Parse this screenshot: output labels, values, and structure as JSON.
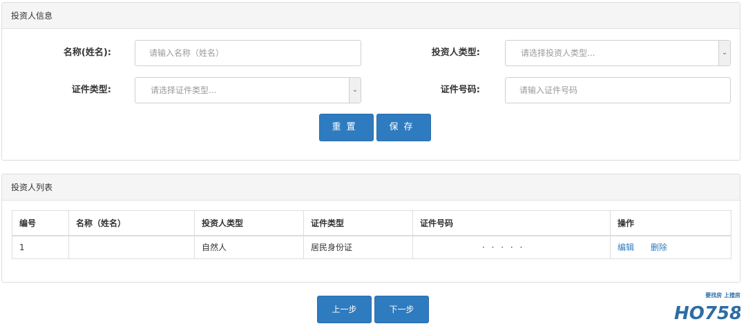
{
  "info_panel": {
    "title": "投资人信息",
    "name_label": "名称(姓名):",
    "name_placeholder": "请输入名称（姓名）",
    "investor_type_label": "投资人类型:",
    "investor_type_placeholder": "请选择投资人类型...",
    "cert_type_label": "证件类型:",
    "cert_type_placeholder": "请选择证件类型...",
    "cert_no_label": "证件号码:",
    "cert_no_placeholder": "请输入证件号码",
    "reset_label": "重置",
    "save_label": "保存"
  },
  "list_panel": {
    "title": "投资人列表",
    "columns": [
      "编号",
      "名称（姓名）",
      "投资人类型",
      "证件类型",
      "证件号码",
      "操作"
    ],
    "rows": [
      {
        "no": "1",
        "name": "",
        "investor_type": "自然人",
        "cert_type": "居民身份证",
        "cert_no": "· · · · ·",
        "edit": "编辑",
        "delete": "删除"
      }
    ]
  },
  "nav": {
    "prev_label": "上一步",
    "next_label": "下一步"
  },
  "logo": {
    "tagline": "要找房 上搜房",
    "text": "HO758"
  },
  "colors": {
    "primary": "#2f7bbf",
    "panel_heading_bg": "#f5f5f5",
    "border": "#dcdcdc"
  }
}
